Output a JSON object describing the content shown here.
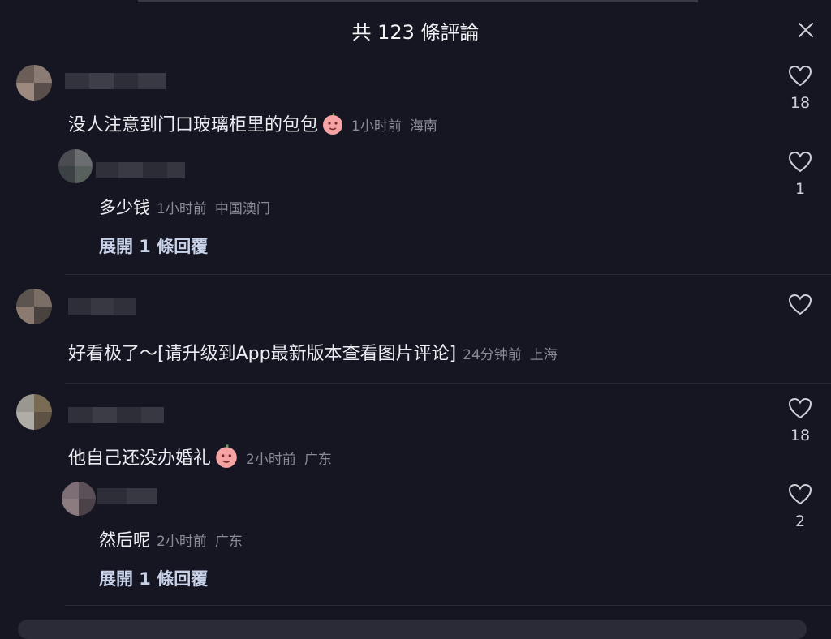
{
  "header": {
    "title": "共 123 條評論"
  },
  "comments": [
    {
      "text": "没人注意到门口玻璃柜里的包包",
      "time": "1小时前",
      "location": "海南",
      "likes": "18",
      "reply": {
        "text": "多少钱",
        "time": "1小时前",
        "location": "中国澳门",
        "likes": "1"
      },
      "expand_label": "展開 1 條回覆"
    },
    {
      "text": "好看极了～[请升级到App最新版本查看图片评论]",
      "time": "24分钟前",
      "location": "上海"
    },
    {
      "text": "他自己还没办婚礼",
      "time": "2小时前",
      "location": "广东",
      "likes": "18",
      "reply": {
        "text": "然后呢",
        "time": "2小时前",
        "location": "广东",
        "likes": "2"
      },
      "expand_label": "展開 1 條回覆"
    }
  ],
  "icons": {
    "close": "close-icon",
    "like": "heart-outline-icon",
    "emoji": "peach-face-emoji-icon"
  },
  "colors": {
    "background": "#161622",
    "text": "#ececf1",
    "meta": "#8b8b96",
    "expand": "#c8d3ea"
  }
}
